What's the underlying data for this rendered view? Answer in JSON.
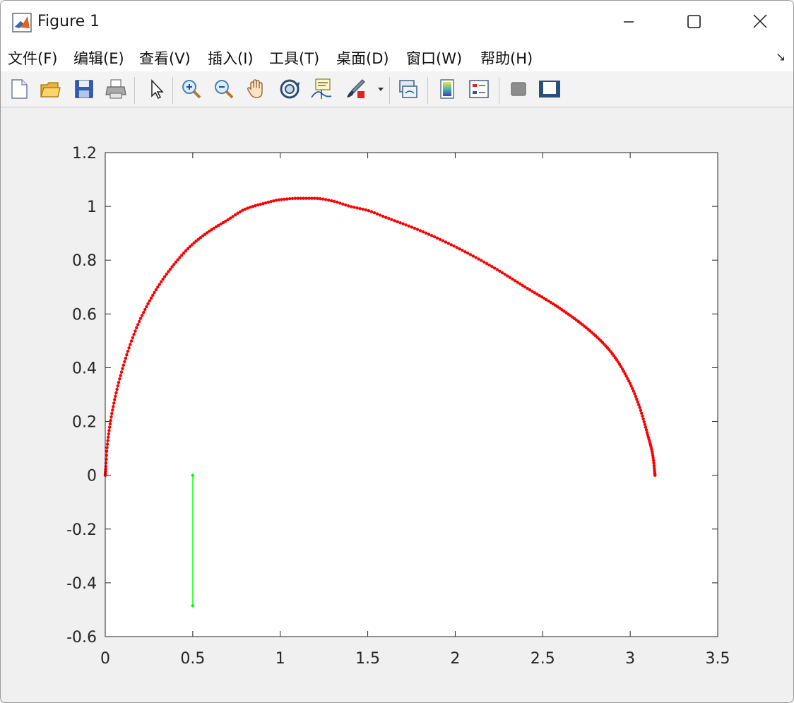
{
  "window": {
    "title": "Figure 1"
  },
  "menu": {
    "items": [
      "文件(F)",
      "编辑(E)",
      "查看(V)",
      "插入(I)",
      "工具(T)",
      "桌面(D)",
      "窗口(W)",
      "帮助(H)"
    ],
    "more_icon": "expand-arrow-icon"
  },
  "toolbar": {
    "icons": [
      "new-figure-icon",
      "open-file-icon",
      "save-icon",
      "print-icon",
      "pointer-icon",
      "zoom-in-icon",
      "zoom-out-icon",
      "pan-hand-icon",
      "rotate-3d-icon",
      "data-cursor-icon",
      "brush-icon",
      "link-plot-icon",
      "colorbar-icon",
      "legend-icon",
      "hide-plot-tools-icon",
      "show-plot-tools-icon"
    ]
  },
  "chart_data": {
    "type": "line",
    "title": "",
    "xlabel": "",
    "ylabel": "",
    "xlim": [
      0,
      3.5
    ],
    "ylim": [
      -0.6,
      1.2
    ],
    "xticks": [
      "0",
      "0.5",
      "1",
      "1.5",
      "2",
      "2.5",
      "3",
      "3.5"
    ],
    "yticks": [
      "-0.6",
      "-0.4",
      "-0.2",
      "0",
      "0.2",
      "0.4",
      "0.6",
      "0.8",
      "1",
      "1.2"
    ],
    "grid": false,
    "series": [
      {
        "color": "#ff0000",
        "marker": "dot",
        "x": [
          0,
          0.01,
          0.03,
          0.06,
          0.1,
          0.15,
          0.2,
          0.3,
          0.4,
          0.5,
          0.6,
          0.7,
          0.8,
          0.9,
          1.0,
          1.1,
          1.2,
          1.3,
          1.4,
          1.5,
          1.6,
          1.8,
          2.0,
          2.2,
          2.4,
          2.6,
          2.8,
          2.9,
          3.0,
          3.05,
          3.1,
          3.13,
          3.1416
        ],
        "y": [
          0,
          0.1,
          0.2,
          0.3,
          0.4,
          0.5,
          0.58,
          0.7,
          0.79,
          0.86,
          0.91,
          0.95,
          0.99,
          1.01,
          1.025,
          1.03,
          1.03,
          1.02,
          1.0,
          0.985,
          0.96,
          0.91,
          0.85,
          0.78,
          0.7,
          0.62,
          0.52,
          0.45,
          0.34,
          0.26,
          0.15,
          0.07,
          0
        ]
      },
      {
        "color": "#00ff00",
        "marker": "dot",
        "x": [
          0.5,
          0.5
        ],
        "y": [
          0,
          -0.485
        ]
      }
    ]
  }
}
